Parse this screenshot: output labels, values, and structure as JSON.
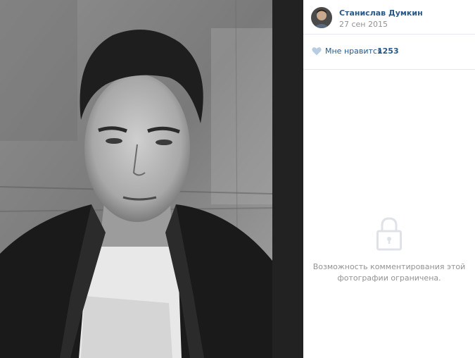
{
  "author": {
    "name": "Станислав Думкин",
    "date": "27 сен 2015",
    "avatar_icon": "user-avatar"
  },
  "likes": {
    "label": "Мне нравится",
    "count": "1253",
    "icon": "heart-icon",
    "color": "#2a5885"
  },
  "comments": {
    "lock_icon": "lock-icon",
    "line1": "Возможность комментирования этой",
    "line2": "фотографии ограничена."
  },
  "colors": {
    "link": "#2a5885",
    "muted": "#939393",
    "viewer_bg": "#222222",
    "divider": "#e7e8ec"
  }
}
